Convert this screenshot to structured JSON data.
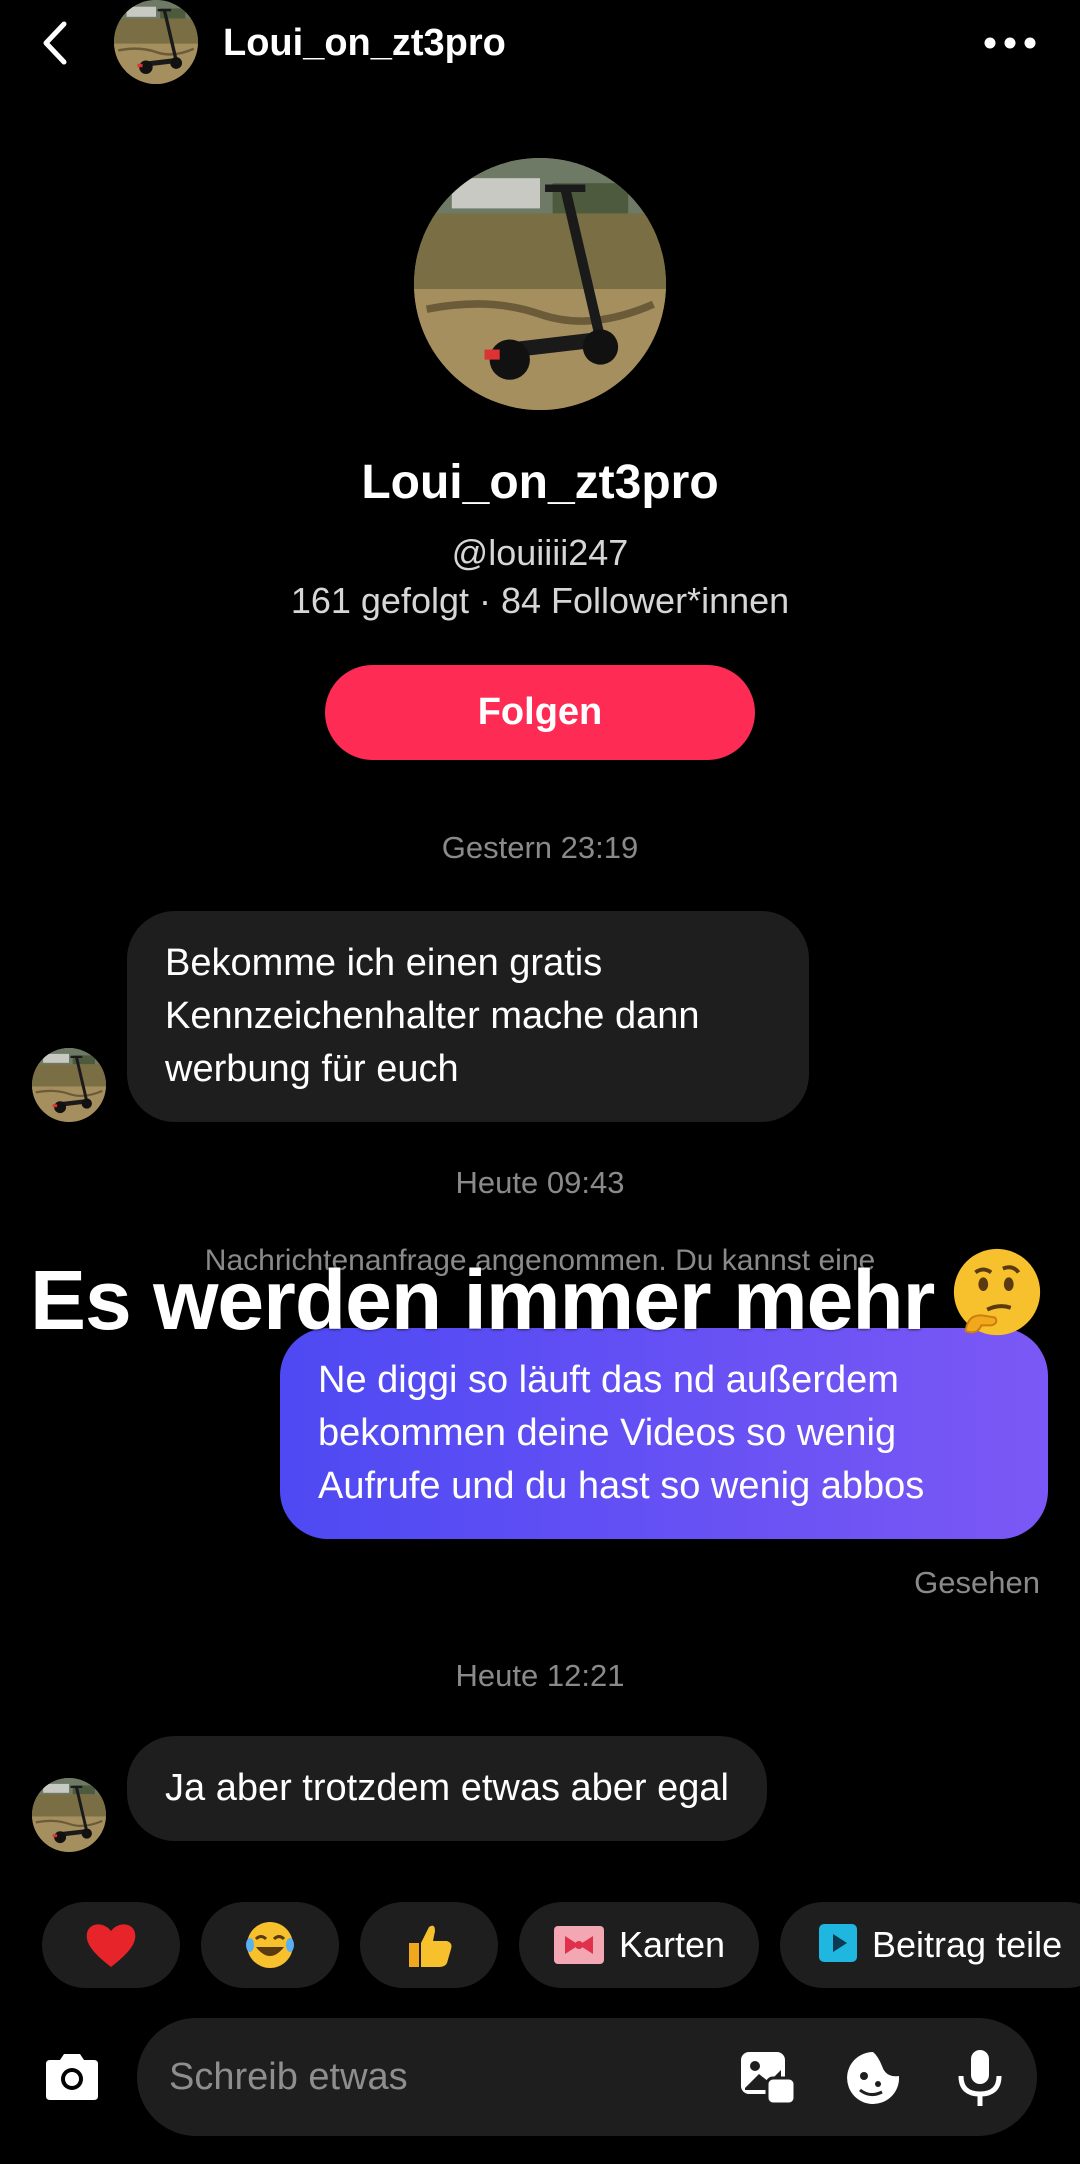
{
  "header": {
    "title": "Loui_on_zt3pro"
  },
  "profile": {
    "name": "Loui_on_zt3pro",
    "handle": "@louiiii247",
    "stats": "161 gefolgt · 84 Follower*innen",
    "follow_label": "Folgen"
  },
  "messages": [
    {
      "timestamp": "Gestern 23:19",
      "direction": "in",
      "lines": [
        "Bekomme ich einen gratis",
        "Kennzeichenhalter mache dann",
        "werbung für euch"
      ]
    },
    {
      "timestamp": "Heute 09:43",
      "direction": "out",
      "lines": [
        "Ne diggi so läuft das nd außerdem",
        "bekommen deine Videos so wenig",
        "Aufrufe und du hast so wenig abbos"
      ],
      "status": "Gesehen"
    },
    {
      "timestamp": "Heute 12:21",
      "direction": "in",
      "lines": [
        "Ja aber trotzdem etwas aber egal"
      ]
    }
  ],
  "system_note": "Nachrichtenanfrage angenommen. Du kannst eine",
  "overlay_caption": "Es werden immer mehr",
  "quick_replies": {
    "heart": "heart-emoji",
    "laugh": "laughing-emoji",
    "thumb": "thumbs-up-emoji",
    "cards_label": "Karten",
    "share_label": "Beitrag teile"
  },
  "composer": {
    "placeholder": "Schreib etwas"
  },
  "colors": {
    "follow": "#fe2c55",
    "bubble_in": "#1e1e1e",
    "bubble_out_start": "#4e49f3",
    "bubble_out_end": "#7b58f5"
  }
}
